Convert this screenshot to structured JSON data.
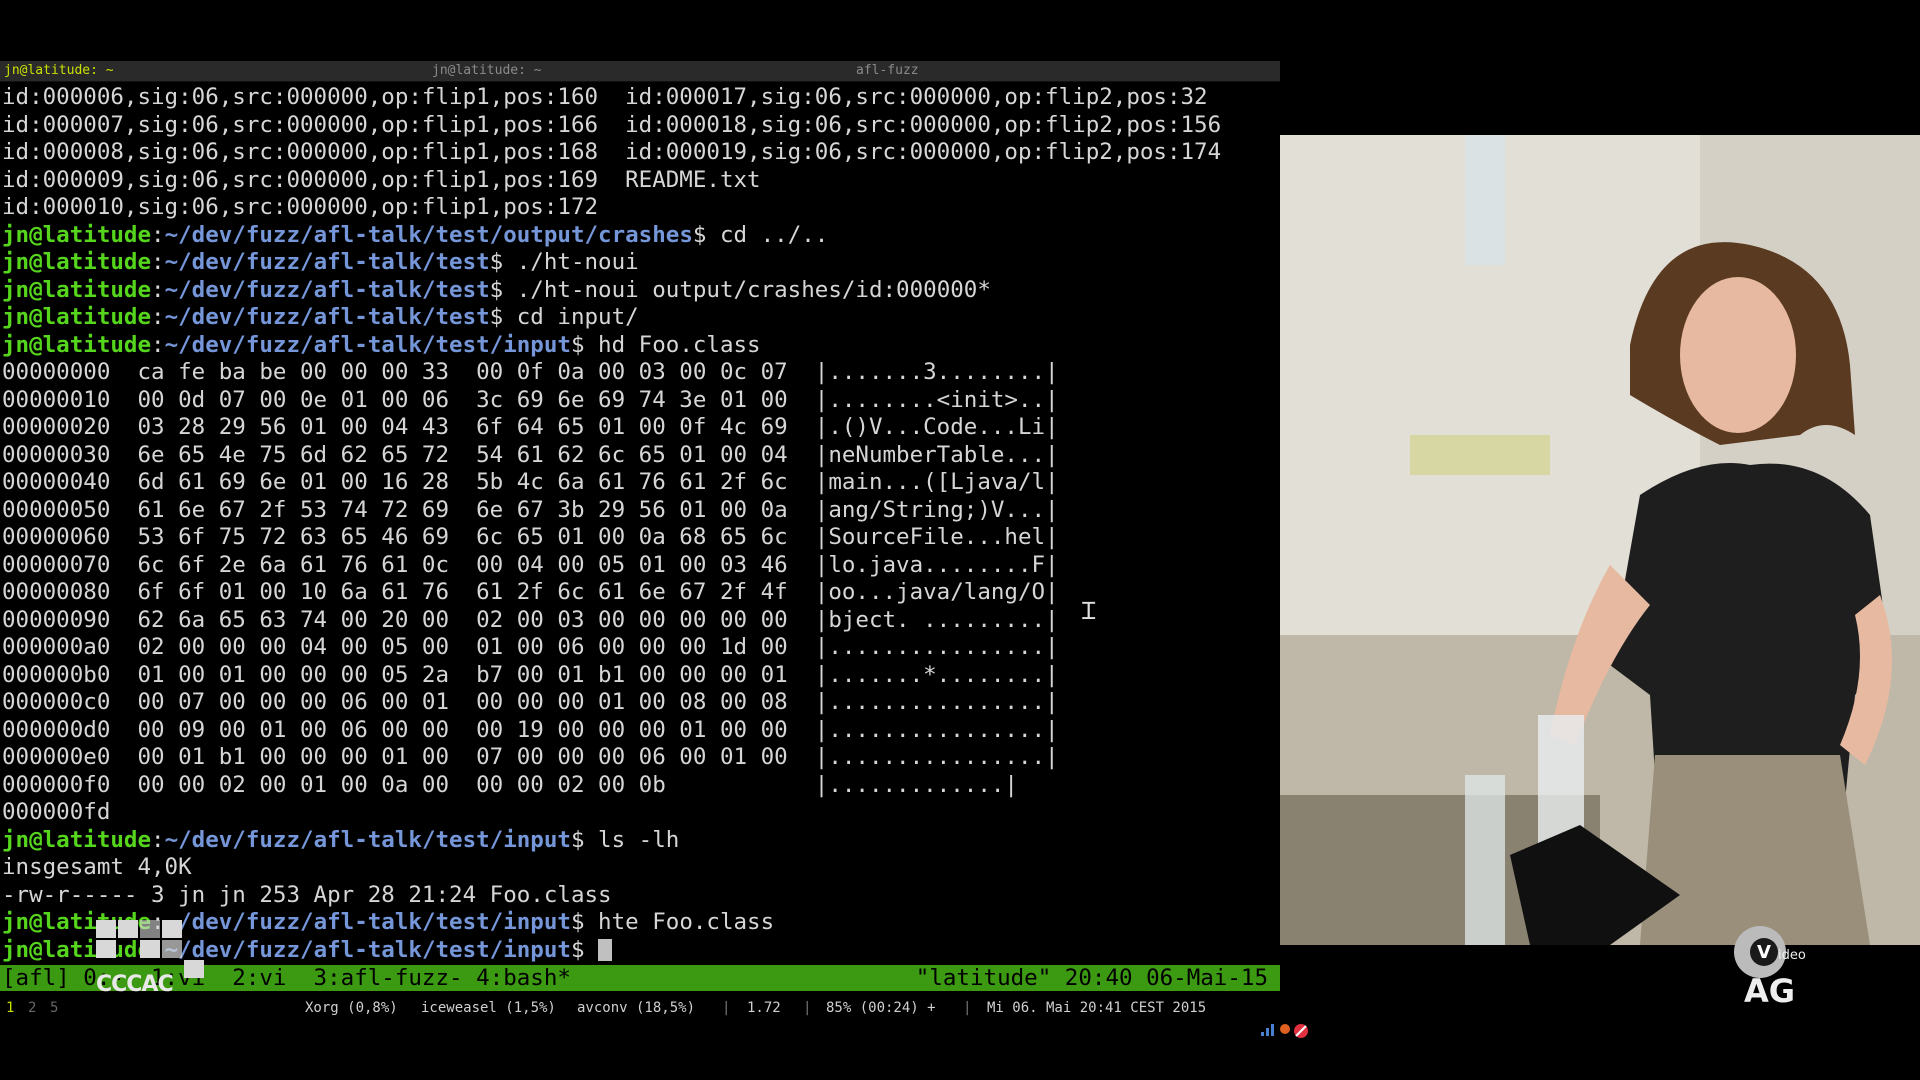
{
  "tabs": [
    "jn@latitude: ~",
    "jn@latitude: ~",
    "afl-fuzz"
  ],
  "terminal": {
    "lines": [
      [
        {
          "t": "id:000006,sig:06,src:000000,op:flip1,pos:160  id:000017,sig:06,src:000000,op:flip2,pos:32"
        }
      ],
      [
        {
          "t": "id:000007,sig:06,src:000000,op:flip1,pos:166  id:000018,sig:06,src:000000,op:flip2,pos:156"
        }
      ],
      [
        {
          "t": "id:000008,sig:06,src:000000,op:flip1,pos:168  id:000019,sig:06,src:000000,op:flip2,pos:174"
        }
      ],
      [
        {
          "t": "id:000009,sig:06,src:000000,op:flip1,pos:169  README.txt"
        }
      ],
      [
        {
          "t": "id:000010,sig:06,src:000000,op:flip1,pos:172"
        }
      ],
      [
        {
          "t": "jn@latitude",
          "c": "g"
        },
        {
          "t": ":"
        },
        {
          "t": "~/dev/fuzz/afl-talk/test/output/crashes",
          "c": "b"
        },
        {
          "t": "$ cd ../.."
        }
      ],
      [
        {
          "t": "jn@latitude",
          "c": "g"
        },
        {
          "t": ":"
        },
        {
          "t": "~/dev/fuzz/afl-talk/test",
          "c": "b"
        },
        {
          "t": "$ ./ht-noui"
        }
      ],
      [
        {
          "t": "jn@latitude",
          "c": "g"
        },
        {
          "t": ":"
        },
        {
          "t": "~/dev/fuzz/afl-talk/test",
          "c": "b"
        },
        {
          "t": "$ ./ht-noui output/crashes/id:000000*"
        }
      ],
      [
        {
          "t": "jn@latitude",
          "c": "g"
        },
        {
          "t": ":"
        },
        {
          "t": "~/dev/fuzz/afl-talk/test",
          "c": "b"
        },
        {
          "t": "$ cd input/"
        }
      ],
      [
        {
          "t": "jn@latitude",
          "c": "g"
        },
        {
          "t": ":"
        },
        {
          "t": "~/dev/fuzz/afl-talk/test/input",
          "c": "b"
        },
        {
          "t": "$ hd Foo.class"
        }
      ],
      [
        {
          "t": "00000000  ca fe ba be 00 00 00 33  00 0f 0a 00 03 00 0c 07  |.......3........|"
        }
      ],
      [
        {
          "t": "00000010  00 0d 07 00 0e 01 00 06  3c 69 6e 69 74 3e 01 00  |........<init>..|"
        }
      ],
      [
        {
          "t": "00000020  03 28 29 56 01 00 04 43  6f 64 65 01 00 0f 4c 69  |.()V...Code...Li|"
        }
      ],
      [
        {
          "t": "00000030  6e 65 4e 75 6d 62 65 72  54 61 62 6c 65 01 00 04  |neNumberTable...|"
        }
      ],
      [
        {
          "t": "00000040  6d 61 69 6e 01 00 16 28  5b 4c 6a 61 76 61 2f 6c  |main...([Ljava/l|"
        }
      ],
      [
        {
          "t": "00000050  61 6e 67 2f 53 74 72 69  6e 67 3b 29 56 01 00 0a  |ang/String;)V...|"
        }
      ],
      [
        {
          "t": "00000060  53 6f 75 72 63 65 46 69  6c 65 01 00 0a 68 65 6c  |SourceFile...hel|"
        }
      ],
      [
        {
          "t": "00000070  6c 6f 2e 6a 61 76 61 0c  00 04 00 05 01 00 03 46  |lo.java........F|"
        }
      ],
      [
        {
          "t": "00000080  6f 6f 01 00 10 6a 61 76  61 2f 6c 61 6e 67 2f 4f  |oo...java/lang/O|"
        }
      ],
      [
        {
          "t": "00000090  62 6a 65 63 74 00 20 00  02 00 03 00 00 00 00 00  |bject. .........|"
        }
      ],
      [
        {
          "t": "000000a0  02 00 00 00 04 00 05 00  01 00 06 00 00 00 1d 00  |................|"
        }
      ],
      [
        {
          "t": "000000b0  01 00 01 00 00 00 05 2a  b7 00 01 b1 00 00 00 01  |.......*........|"
        }
      ],
      [
        {
          "t": "000000c0  00 07 00 00 00 06 00 01  00 00 00 01 00 08 00 08  |................|"
        }
      ],
      [
        {
          "t": "000000d0  00 09 00 01 00 06 00 00  00 19 00 00 00 01 00 00  |................|"
        }
      ],
      [
        {
          "t": "000000e0  00 01 b1 00 00 00 01 00  07 00 00 00 06 00 01 00  |................|"
        }
      ],
      [
        {
          "t": "000000f0  00 00 02 00 01 00 0a 00  00 00 02 00 0b           |.............|"
        }
      ],
      [
        {
          "t": "000000fd"
        }
      ],
      [
        {
          "t": "jn@latitude",
          "c": "g"
        },
        {
          "t": ":"
        },
        {
          "t": "~/dev/fuzz/afl-talk/test/input",
          "c": "b"
        },
        {
          "t": "$ ls -lh"
        }
      ],
      [
        {
          "t": "insgesamt 4,0K"
        }
      ],
      [
        {
          "t": "-rw-r----- 3 jn jn 253 Apr 28 21:24 Foo.class"
        }
      ],
      [
        {
          "t": "jn@latitude",
          "c": "g"
        },
        {
          "t": ":"
        },
        {
          "t": "~/dev/fuzz/afl-talk/test/input",
          "c": "b"
        },
        {
          "t": "$ hte Foo.class"
        }
      ],
      [
        {
          "t": "jn@latitude",
          "c": "g"
        },
        {
          "t": ":"
        },
        {
          "t": "~/dev/fuzz/afl-talk/test/input",
          "c": "b"
        },
        {
          "t": "$ "
        },
        {
          "t": "",
          "c": "cur"
        }
      ]
    ]
  },
  "tmux": {
    "left": "[afl] 0:-  1:vi  2:vi  3:afl-fuzz- 4:bash*",
    "right": "\"latitude\" 20:40 06-Mai-15"
  },
  "sysbar": {
    "workspaces": [
      "1",
      "2",
      "5"
    ],
    "xorg": "Xorg (0,8%)",
    "iceweasel": "iceweasel (1,5%)",
    "avconv": "avconv (18,5%)",
    "load": "1.72",
    "battery": "85% (00:24) +",
    "datetime": "Mi 06. Mai 20:41 CEST 2015"
  },
  "logos": {
    "left": "CCCAC",
    "right_small": "ideo",
    "right_big": "AG"
  },
  "colors": {
    "prompt_user": "#55d61c",
    "prompt_path": "#7596d8",
    "tmux_bar": "#3c9a12",
    "active_tab": "#c8e000"
  }
}
